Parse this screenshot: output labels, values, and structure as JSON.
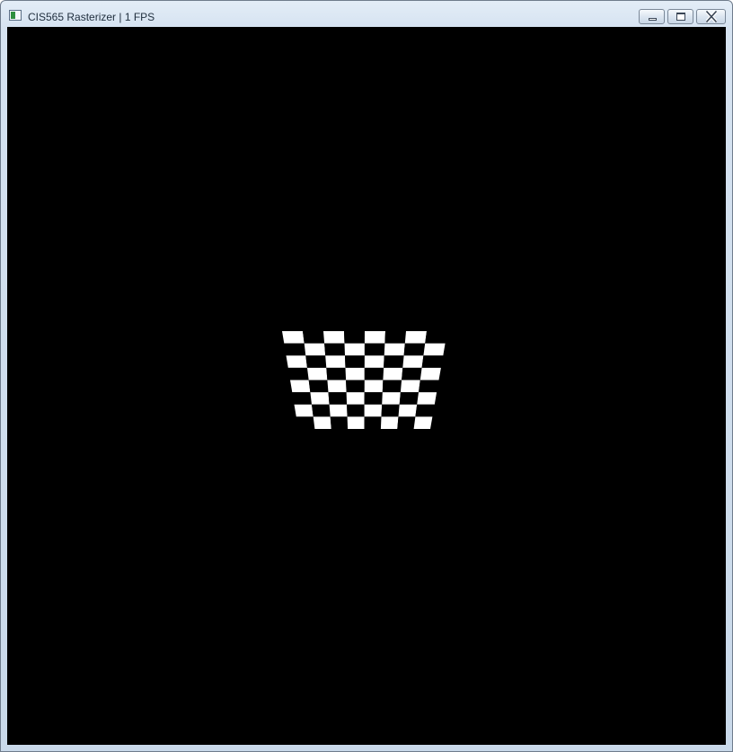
{
  "window": {
    "title": "CIS565 Rasterizer | 1 FPS"
  },
  "caption_buttons": {
    "minimize_icon": "minimize-icon",
    "maximize_icon": "maximize-icon",
    "close_icon": "close-icon"
  },
  "viewport": {
    "background": "#000000",
    "scene": {
      "object": "checkerboard plane",
      "rows": 8,
      "columns": 8,
      "light_color": "#ffffff",
      "dark_color": "#000000"
    }
  }
}
